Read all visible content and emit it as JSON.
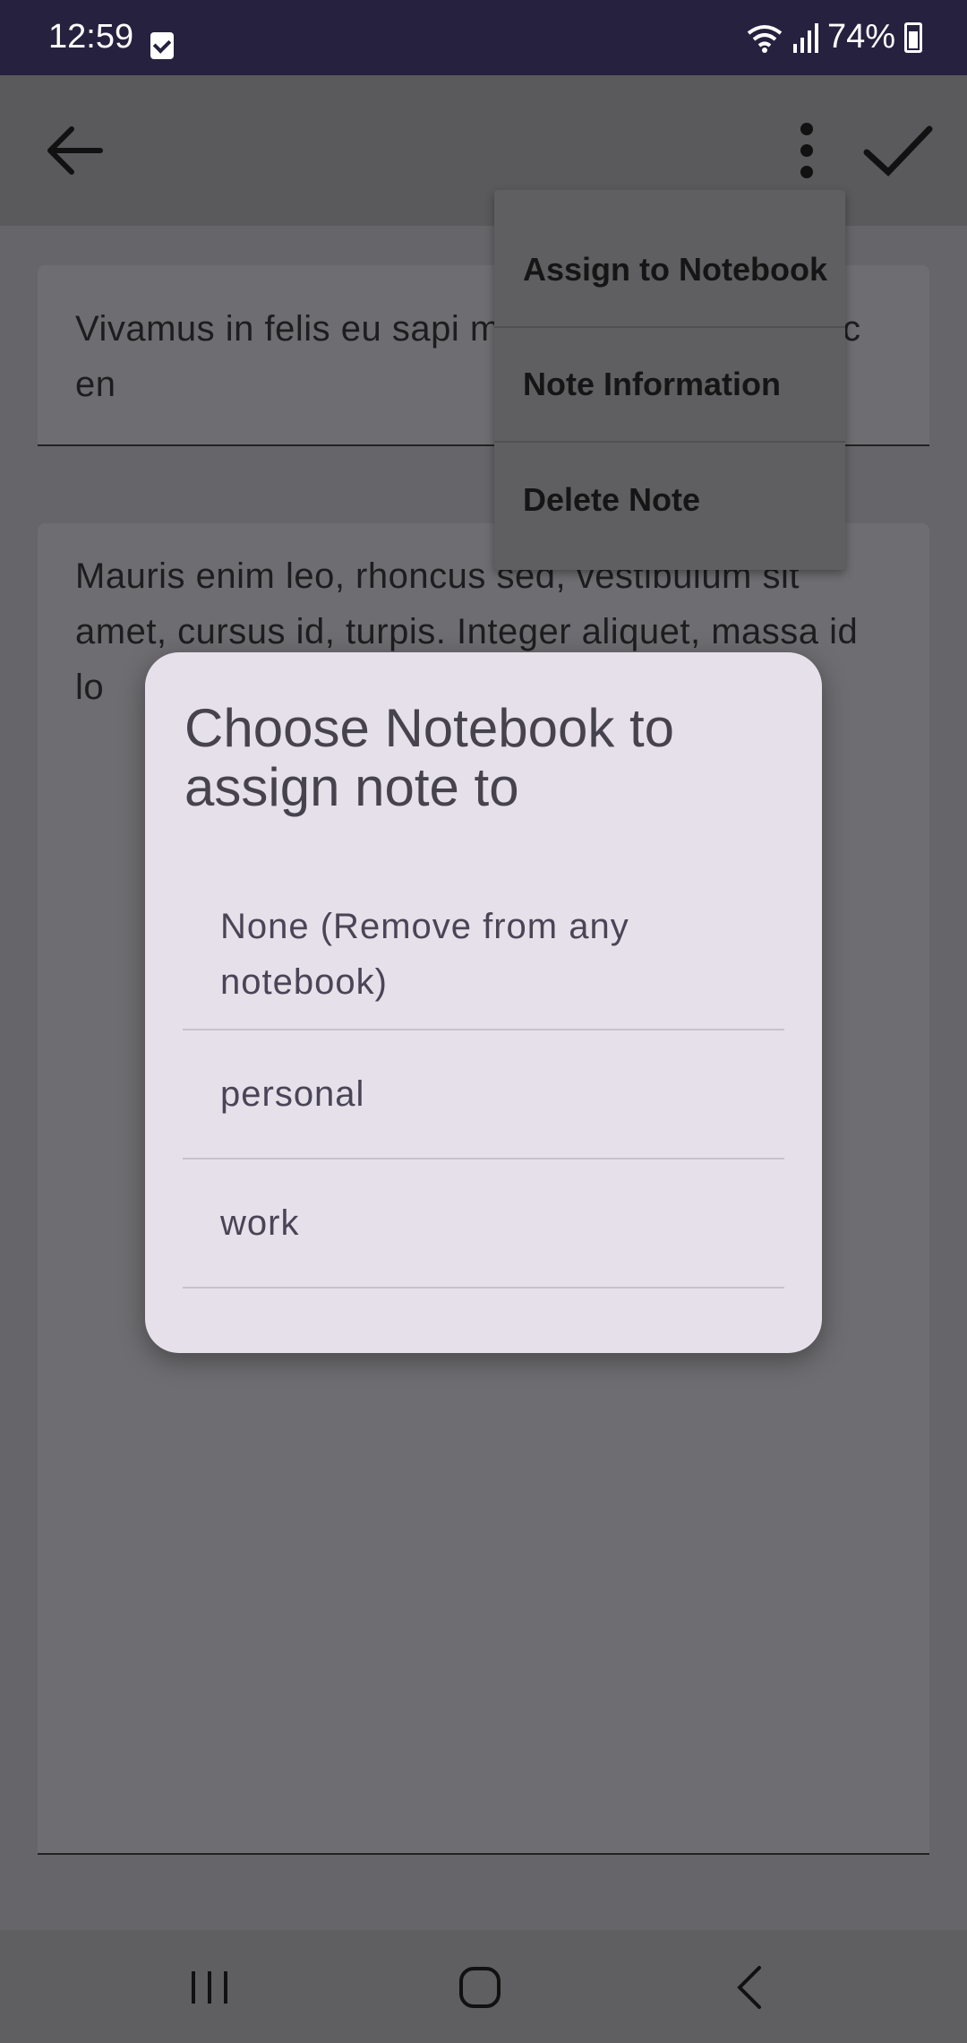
{
  "status_bar": {
    "time": "12:59",
    "battery": "74%"
  },
  "app_bar": {
    "back_icon": "arrow-left-icon",
    "more_icon": "more-vert-icon",
    "save_icon": "check-icon"
  },
  "note": {
    "title": "Vivamus in felis eu sapi                           m. Proin eu mi. Nulla ac en",
    "body": "Mauris enim leo, rhoncus sed, vestibulum sit amet, cursus id, turpis. Integer aliquet, massa id lo"
  },
  "menu": {
    "items": [
      "Assign to Notebook",
      "Note Information",
      "Delete Note"
    ]
  },
  "dialog": {
    "title": "Choose Notebook to assign note to",
    "options": [
      "None (Remove from any notebook)",
      "personal",
      "work"
    ]
  },
  "colors": {
    "dialog_bg": "#e6e0ea",
    "status_bar": "#272140",
    "scrim": "#666569"
  }
}
